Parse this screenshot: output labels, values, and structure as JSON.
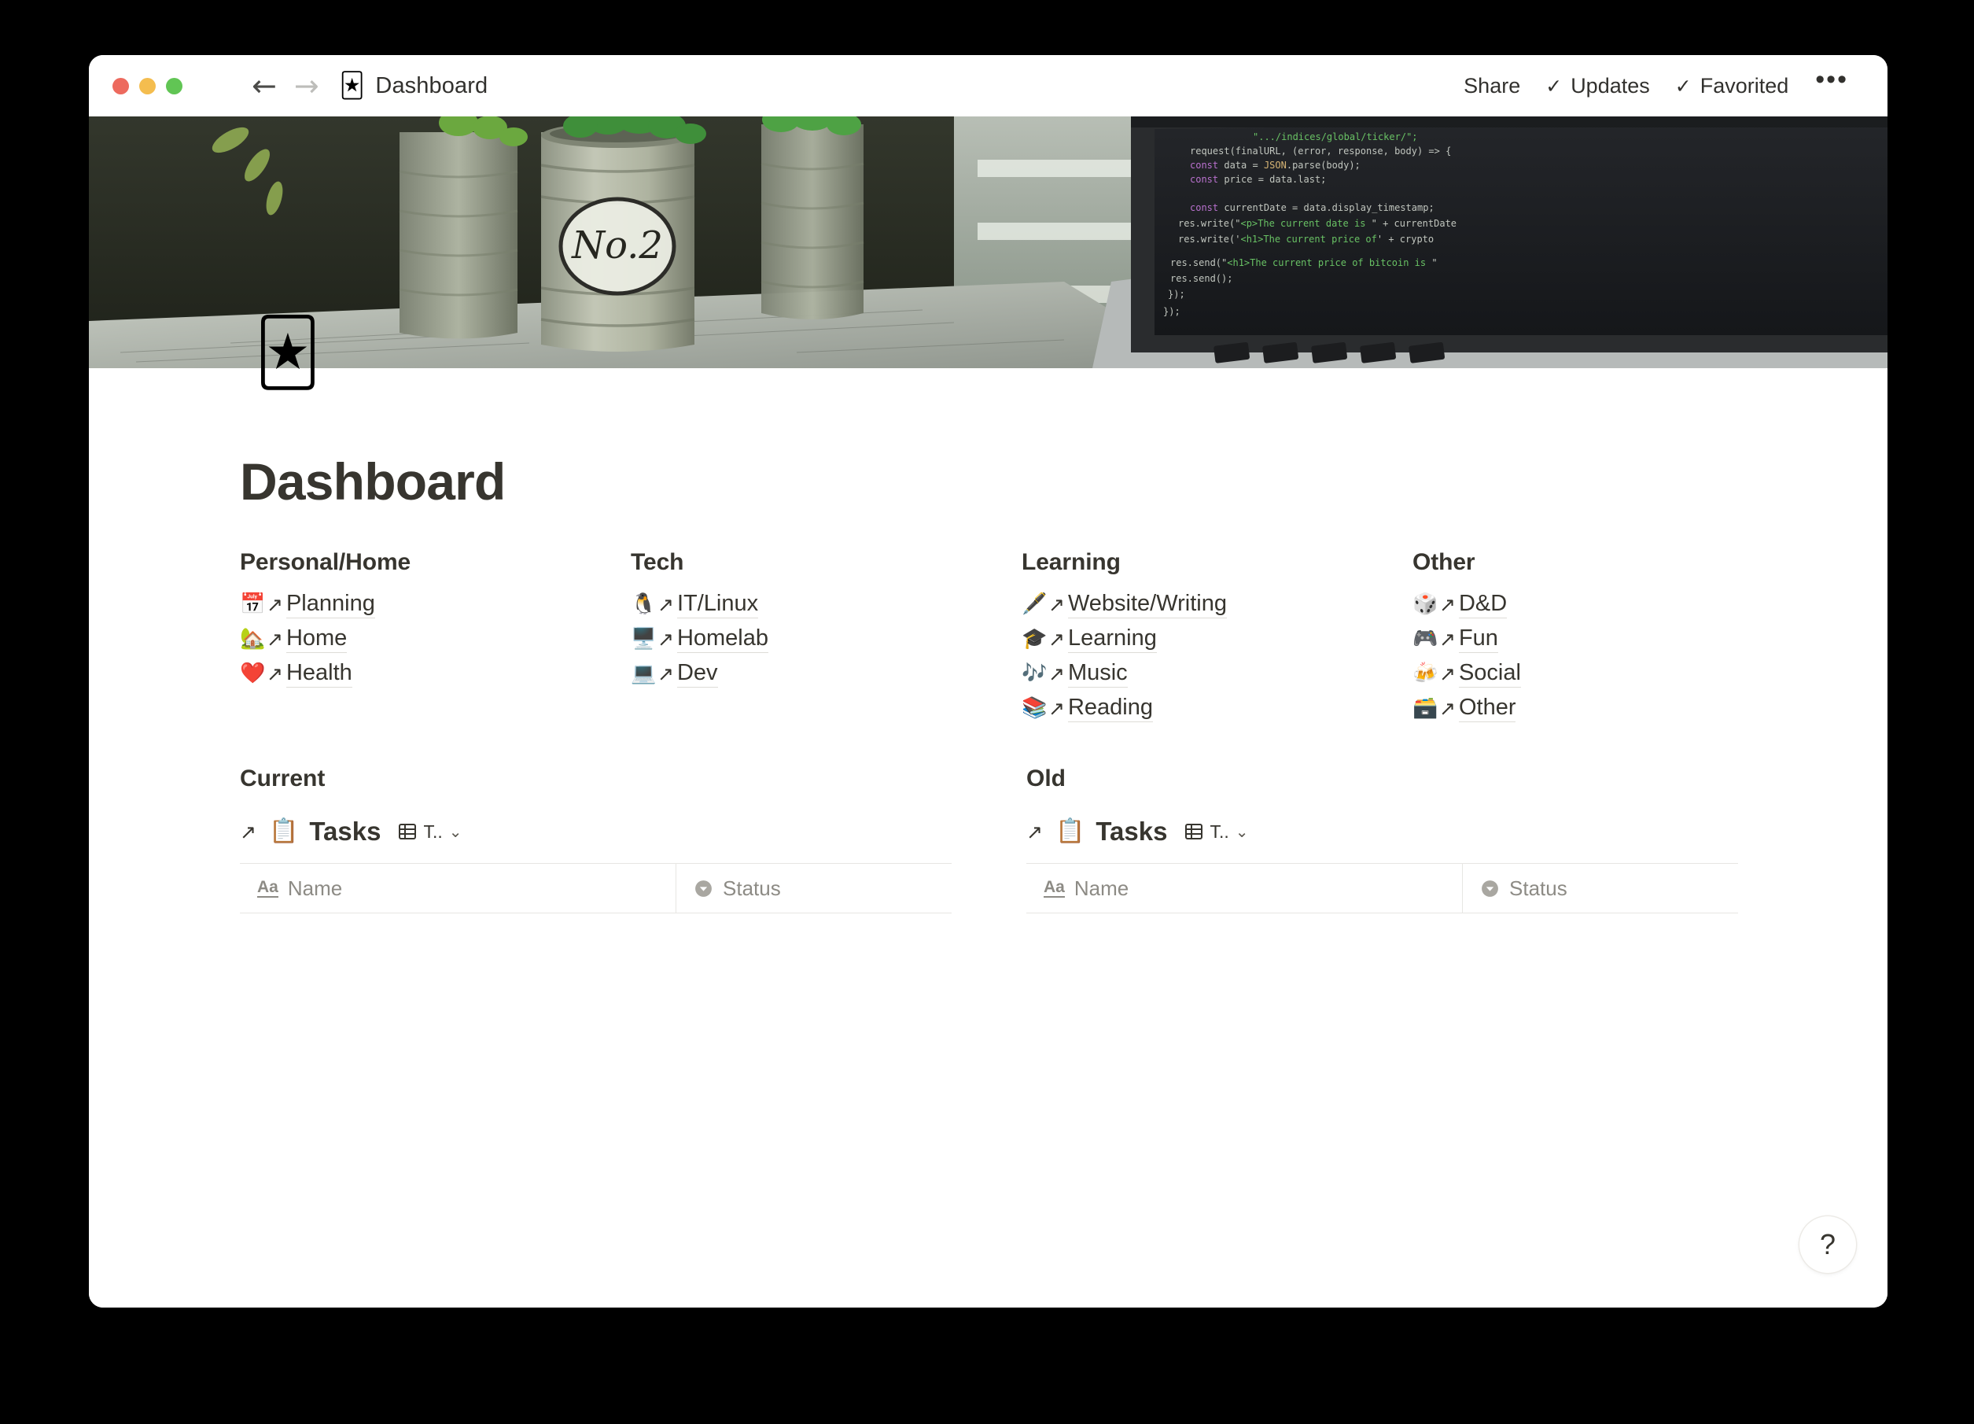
{
  "window": {
    "titlebar": {
      "traffic_lights": [
        "close",
        "minimize",
        "maximize"
      ],
      "menu_icon": "hamburger-icon",
      "back_label": "←",
      "forward_label": "→",
      "page_icon": "🃏",
      "title": "Dashboard",
      "share_label": "Share",
      "updates_label": "Updates",
      "favorited_label": "Favorited",
      "check_glyph": "✓",
      "more_label": "•••"
    }
  },
  "page": {
    "icon": "🃏",
    "title": "Dashboard",
    "columns": [
      {
        "heading": "Personal/Home",
        "links": [
          {
            "emoji": "📅",
            "icon_name": "calendar-emoji",
            "arrow": "↗",
            "label": "Planning"
          },
          {
            "emoji": "🏡",
            "icon_name": "house-with-garden-emoji",
            "arrow": "↗",
            "label": "Home"
          },
          {
            "emoji": "❤️",
            "icon_name": "red-heart-emoji",
            "arrow": "↗",
            "label": "Health"
          }
        ]
      },
      {
        "heading": "Tech",
        "links": [
          {
            "emoji": "🐧",
            "icon_name": "penguin-emoji",
            "arrow": "↗",
            "label": "IT/Linux"
          },
          {
            "emoji": "🖥️",
            "icon_name": "desktop-computer-emoji",
            "arrow": "↗",
            "label": "Homelab"
          },
          {
            "emoji": "💻",
            "icon_name": "laptop-emoji",
            "arrow": "↗",
            "label": "Dev"
          }
        ]
      },
      {
        "heading": "Learning",
        "links": [
          {
            "emoji": "🖋️",
            "icon_name": "fountain-pen-emoji",
            "arrow": "↗",
            "label": "Website/Writing"
          },
          {
            "emoji": "🎓",
            "icon_name": "graduation-cap-emoji",
            "arrow": "↗",
            "label": "Learning"
          },
          {
            "emoji": "🎶",
            "icon_name": "musical-notes-emoji",
            "arrow": "↗",
            "label": "Music"
          },
          {
            "emoji": "📚",
            "icon_name": "books-emoji",
            "arrow": "↗",
            "label": "Reading"
          }
        ]
      },
      {
        "heading": "Other",
        "links": [
          {
            "emoji": "🎲",
            "icon_name": "game-die-emoji",
            "arrow": "↗",
            "label": "D&D"
          },
          {
            "emoji": "🎮",
            "icon_name": "video-game-controller-emoji",
            "arrow": "↗",
            "label": "Fun"
          },
          {
            "emoji": "🍻",
            "icon_name": "clinking-beer-mugs-emoji",
            "arrow": "↗",
            "label": "Social"
          },
          {
            "emoji": "🗃️",
            "icon_name": "card-file-box-emoji",
            "arrow": "↗",
            "label": "Other"
          }
        ]
      }
    ],
    "databases": [
      {
        "heading": "Current",
        "open_arrow": "↗",
        "emoji": "📋",
        "name": "Tasks",
        "view_label": "T..",
        "view_caret": "⌄",
        "columns": [
          {
            "prop_type": "title",
            "prop_glyph": "Aa",
            "label": "Name"
          },
          {
            "prop_type": "select",
            "prop_glyph": "select-icon",
            "label": "Status"
          }
        ]
      },
      {
        "heading": "Old",
        "open_arrow": "↗",
        "emoji": "📋",
        "name": "Tasks",
        "view_label": "T..",
        "view_caret": "⌄",
        "columns": [
          {
            "prop_type": "title",
            "prop_glyph": "Aa",
            "label": "Name"
          },
          {
            "prop_type": "select",
            "prop_glyph": "select-icon",
            "label": "Status"
          }
        ]
      }
    ],
    "help_button_label": "?"
  },
  "colors": {
    "text": "#37352f",
    "muted": "#8d8b85",
    "divider": "#e7e6e3",
    "underline": "#dedcd7",
    "traffic_red": "#ed6a5e",
    "traffic_yellow": "#f4bd4f",
    "traffic_green": "#61c554"
  }
}
